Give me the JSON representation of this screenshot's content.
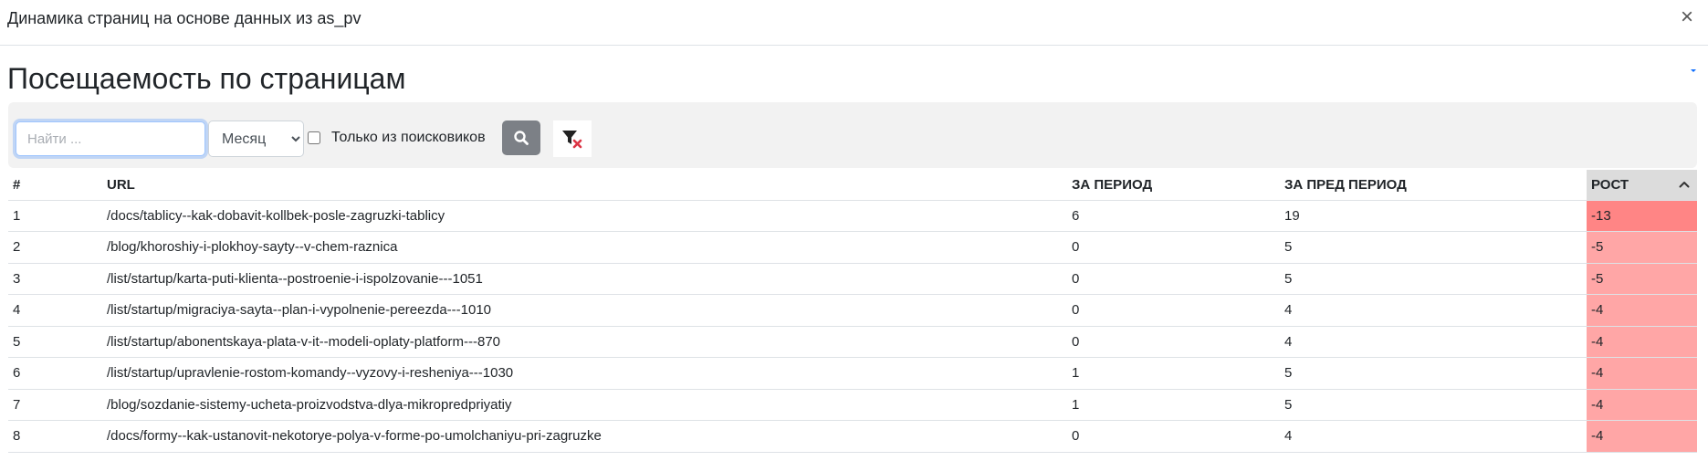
{
  "modal": {
    "title": "Динамика страниц на основе данных из as_pv",
    "close_symbol": "×"
  },
  "page": {
    "heading": "Посещаемость по страницам"
  },
  "filters": {
    "search_placeholder": "Найти ...",
    "search_value": "",
    "period_options": [
      "Месяц"
    ],
    "period_selected": "Месяц",
    "search_engines_only_label": "Только из поисковиков",
    "search_engines_only_checked": false,
    "search_button_icon": "search-icon",
    "clear_filter_icon": "filter-clear-icon"
  },
  "table": {
    "columns": [
      "#",
      "URL",
      "За период",
      "За пред период",
      "Рост"
    ],
    "sort_column": "Рост",
    "sort_direction": "ascending",
    "rows": [
      {
        "num": "1",
        "url": "/docs/tablicy--kak-dobavit-kollbek-posle-zagruzki-tablicy",
        "period": "6",
        "prev_period": "19",
        "growth": "-13"
      },
      {
        "num": "2",
        "url": "/blog/khoroshiy-i-plokhoy-sayty--v-chem-raznica",
        "period": "0",
        "prev_period": "5",
        "growth": "-5"
      },
      {
        "num": "3",
        "url": "/list/startup/karta-puti-klienta--postroenie-i-ispolzovanie---1051",
        "period": "0",
        "prev_period": "5",
        "growth": "-5"
      },
      {
        "num": "4",
        "url": "/list/startup/migraciya-sayta--plan-i-vypolnenie-pereezda---1010",
        "period": "0",
        "prev_period": "4",
        "growth": "-4"
      },
      {
        "num": "5",
        "url": "/list/startup/abonentskaya-plata-v-it--modeli-oplaty-platform---870",
        "period": "0",
        "prev_period": "4",
        "growth": "-4"
      },
      {
        "num": "6",
        "url": "/list/startup/upravlenie-rostom-komandy--vyzovy-i-resheniya---1030",
        "period": "1",
        "prev_period": "5",
        "growth": "-4"
      },
      {
        "num": "7",
        "url": "/blog/sozdanie-sistemy-ucheta-proizvodstva-dlya-mikropredpriyatiy",
        "period": "1",
        "prev_period": "5",
        "growth": "-4"
      },
      {
        "num": "8",
        "url": "/docs/formy--kak-ustanovit-nekotorye-polya-v-forme-po-umolchaniyu-pri-zagruzke",
        "period": "0",
        "prev_period": "4",
        "growth": "-4"
      }
    ]
  },
  "colors": {
    "growth_strong_negative": "#ff8585",
    "growth_negative": "#ffa6a6",
    "sorted_header_bg": "#dcdcdc",
    "filter_bar_bg": "#f2f2f2",
    "search_button_bg": "#7c8086",
    "clear_filter_accent": "#dc3545"
  }
}
